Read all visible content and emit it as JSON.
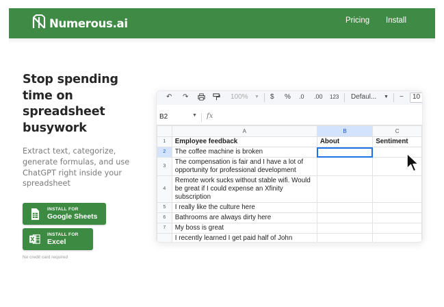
{
  "header": {
    "brand": "Numerous.ai",
    "nav": [
      "Pricing",
      "Install"
    ],
    "bar_color": "#3f8a44"
  },
  "hero": {
    "headline": "Stop spending time on spreadsheet busywork",
    "subtext": "Extract text, categorize, generate formulas, and use ChatGPT right inside your spreadsheet",
    "buttons": [
      {
        "small": "INSTALL FOR",
        "big": "Google Sheets",
        "icon": "google-sheets-icon"
      },
      {
        "small": "INSTALL FOR",
        "big": "Excel",
        "icon": "excel-icon"
      }
    ],
    "note": "No credit card required"
  },
  "spreadsheet": {
    "toolbar": {
      "zoom": "100%",
      "currency": "$",
      "percent": "%",
      "dec_decrease": ".0",
      "dec_increase": ".00",
      "number_format": "123",
      "font": "Defaul...",
      "minus": "−",
      "font_size": "10"
    },
    "cell_ref": "B2",
    "fx": "fx",
    "columns": [
      "A",
      "B",
      "C"
    ],
    "header_row": [
      "Employee feedback",
      "About",
      "Sentiment"
    ],
    "rows": [
      {
        "num": "2",
        "text": "The coffee machine is broken"
      },
      {
        "num": "3",
        "text": "The compensation is fair and I have a lot of opportunity for professional development"
      },
      {
        "num": "4",
        "text": "Remote work sucks without stable wifi. Would be great if I could expense an Xfinity subscription"
      },
      {
        "num": "5",
        "text": "I really like the culture here"
      },
      {
        "num": "6",
        "text": "Bathrooms are always dirty here"
      },
      {
        "num": "7",
        "text": "My boss is great"
      },
      {
        "num": "8",
        "text": "I recently learned I get paid half of John Culliver even though I work at least twice as hard...  The"
      }
    ],
    "row1_num": "1"
  }
}
